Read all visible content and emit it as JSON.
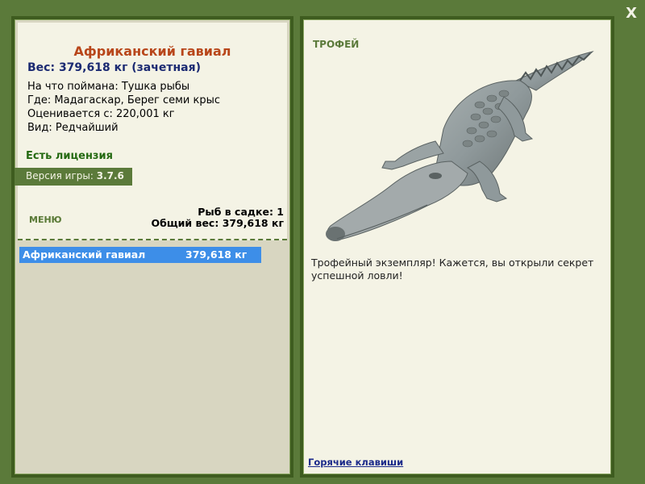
{
  "window": {
    "close_label": "X"
  },
  "fish": {
    "name": "Африканский гавиал",
    "weight_line": "Вес: 379,618 кг (зачетная)",
    "caught_on": "На что поймана: Тушка рыбы",
    "location": "Где: Мадагаскар, Берег семи крыс",
    "value": "Оценивается с: 220,001 кг",
    "rarity": "Вид: Редчайший"
  },
  "license": "Есть лицензия",
  "version": {
    "label": "Версия игры:",
    "value": "3.7.6"
  },
  "menu_label": "МЕНЮ",
  "cage": {
    "count_line": "Рыб в садке: 1",
    "total_line": "Общий вес: 379,618 кг",
    "items": [
      {
        "name": "Африканский гавиал",
        "weight": "379,618 кг"
      }
    ]
  },
  "trophy": {
    "label": "ТРОФЕЙ",
    "text": "Трофейный экземпляр! Кажется, вы открыли секрет успешной ловли!"
  },
  "hotkeys_label": "Горячие клавиши",
  "colors": {
    "frame": "#5b7a3a",
    "title": "#b8461a",
    "weight": "#1b2a72",
    "license": "#256a12",
    "selection": "#3d8ee8"
  }
}
